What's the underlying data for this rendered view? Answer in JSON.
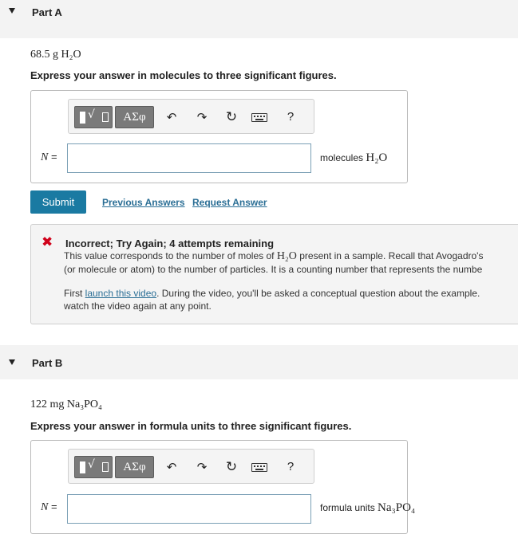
{
  "part_a": {
    "title": "Part A",
    "problem_qty": "68.5 g ",
    "problem_formula": "H₂O",
    "instruction": "Express your answer in molecules to three significant figures.",
    "answer_label": "N",
    "answer_value": "",
    "units_prefix": "molecules ",
    "units_formula": "H₂O",
    "submit_label": "Submit",
    "previous_answers_label": "Previous Answers",
    "request_answer_label": "Request Answer"
  },
  "toolbar": {
    "greek_label": "ΑΣφ",
    "help_label": "?"
  },
  "feedback": {
    "title": "Incorrect; Try Again; 4 attempts remaining",
    "line1_a": "This value corresponds to the number of moles of ",
    "line1_formula": "H₂O",
    "line1_b": " present in a sample. Recall that Avogadro's",
    "line2": "(or molecule or atom) to the number of particles. It is a counting number that represents the numbe",
    "line3_a": "First ",
    "line3_link": "launch this video",
    "line3_b": ". During the video, you'll be asked a conceptual question about the example. ",
    "line4": "watch the video again at any point."
  },
  "part_b": {
    "title": "Part B",
    "problem_qty": "122 mg ",
    "problem_formula": "Na₃PO₄",
    "instruction": "Express your answer in formula units to three significant figures.",
    "answer_label": "N",
    "answer_value": "",
    "units_prefix": "formula units ",
    "units_formula": "Na₃PO₄"
  }
}
